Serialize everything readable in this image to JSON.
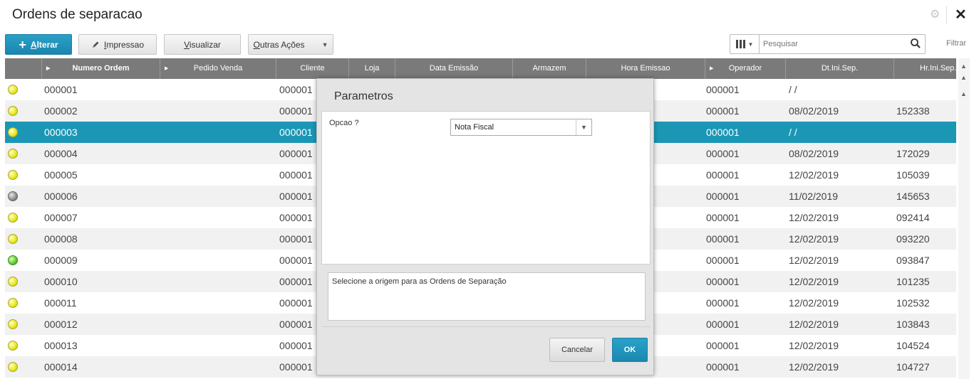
{
  "window": {
    "title": "Ordens de separacao",
    "close_glyph": "✕",
    "gear_glyph": "⚙"
  },
  "toolbar": {
    "alterar": {
      "prefix": "+",
      "mnemonic": "A",
      "rest": "lterar"
    },
    "impressao": {
      "mnemonic": "I",
      "rest": "mpressao"
    },
    "visualizar": {
      "mnemonic": "V",
      "rest": "isualizar"
    },
    "outras": {
      "mnemonic": "O",
      "rest": "utras Ações"
    },
    "search_placeholder": "Pesquisar",
    "filtrar": "Filtrar"
  },
  "grid": {
    "columns": [
      "Numero Ordem",
      "Pedido Venda",
      "Cliente",
      "Loja",
      "Data Emissão",
      "Armazem",
      "Hora Emissao",
      "Operador",
      "Dt.Ini.Sep.",
      "Hr.Ini.Sep."
    ],
    "rows": [
      {
        "status": "yellow",
        "numero": "000001",
        "cliente": "000001",
        "operador": "000001",
        "dt": " /  /",
        "hr": ""
      },
      {
        "status": "yellow",
        "numero": "000002",
        "cliente": "000001",
        "operador": "000001",
        "dt": "08/02/2019",
        "hr": "152338"
      },
      {
        "status": "yellow",
        "numero": "000003",
        "cliente": "000001",
        "operador": "000001",
        "dt": " /  /",
        "hr": "",
        "selected": true
      },
      {
        "status": "yellow",
        "numero": "000004",
        "cliente": "000001",
        "operador": "000001",
        "dt": "08/02/2019",
        "hr": "172029"
      },
      {
        "status": "yellow",
        "numero": "000005",
        "cliente": "000001",
        "operador": "000001",
        "dt": "12/02/2019",
        "hr": "105039"
      },
      {
        "status": "gray",
        "numero": "000006",
        "cliente": "000001",
        "operador": "000001",
        "dt": "11/02/2019",
        "hr": "145653"
      },
      {
        "status": "yellow",
        "numero": "000007",
        "cliente": "000001",
        "operador": "000001",
        "dt": "12/02/2019",
        "hr": "092414"
      },
      {
        "status": "yellow",
        "numero": "000008",
        "cliente": "000001",
        "operador": "000001",
        "dt": "12/02/2019",
        "hr": "093220"
      },
      {
        "status": "green",
        "numero": "000009",
        "cliente": "000001",
        "operador": "000001",
        "dt": "12/02/2019",
        "hr": "093847"
      },
      {
        "status": "yellow",
        "numero": "000010",
        "cliente": "000001",
        "operador": "000001",
        "dt": "12/02/2019",
        "hr": "101235"
      },
      {
        "status": "yellow",
        "numero": "000011",
        "cliente": "000001",
        "operador": "000001",
        "dt": "12/02/2019",
        "hr": "102532"
      },
      {
        "status": "yellow",
        "numero": "000012",
        "cliente": "000001",
        "operador": "000001",
        "dt": "12/02/2019",
        "hr": "103843"
      },
      {
        "status": "yellow",
        "numero": "000013",
        "cliente": "000001",
        "operador": "000001",
        "dt": "12/02/2019",
        "hr": "104524"
      },
      {
        "status": "yellow",
        "numero": "000014",
        "cliente": "000001",
        "operador": "000001",
        "dt": "12/02/2019",
        "hr": "104727"
      }
    ]
  },
  "dialog": {
    "title": "Parametros",
    "field_label": "Opcao ?",
    "field_value": "Nota Fiscal",
    "help_text": "Selecione a origem para as Ordens de Separação",
    "cancel_label": "Cancelar",
    "ok_label": "OK"
  },
  "colors": {
    "accent": "#1b97b5",
    "header_bg": "#7a7a7a"
  }
}
